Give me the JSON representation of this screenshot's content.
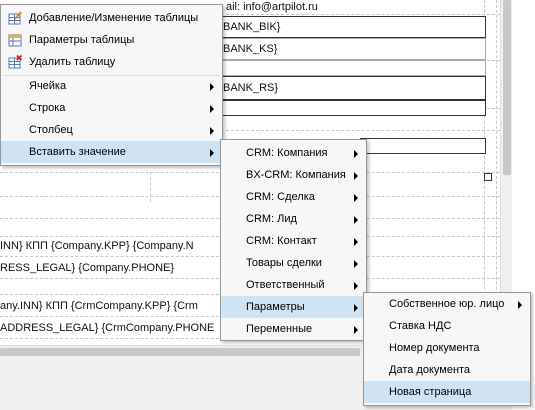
{
  "document": {
    "header_email": "ail: info@artpilot.ru",
    "field_bik": "BANK_BIK}",
    "field_ks": "BANK_KS}",
    "field_rs": "BANK_RS}",
    "row1": "INN} КПП {Company.KPP} {Company.N",
    "row2": "RESS_LEGAL} {Company.PHONE}",
    "row3": "any.INN} КПП {CrmCompany.KPP} {Crm",
    "row4": "ADDRESS_LEGAL} {CrmCompany.PHONE"
  },
  "menu1": {
    "items": [
      {
        "label": "Добавление/Изменение таблицы",
        "icon": "table-edit-icon"
      },
      {
        "label": "Параметры таблицы",
        "icon": "table-properties-icon"
      },
      {
        "label": "Удалить таблицу",
        "icon": "table-delete-icon"
      },
      {
        "label": "Ячейка"
      },
      {
        "label": "Строка"
      },
      {
        "label": "Столбец"
      },
      {
        "label": "Вставить значение"
      }
    ]
  },
  "menu2": {
    "items": [
      {
        "label": "CRM: Компания"
      },
      {
        "label": "BX-CRM: Компания"
      },
      {
        "label": "CRM: Сделка"
      },
      {
        "label": "CRM: Лид"
      },
      {
        "label": "CRM: Контакт"
      },
      {
        "label": "Товары сделки"
      },
      {
        "label": "Ответственный"
      },
      {
        "label": "Параметры"
      },
      {
        "label": "Переменные"
      }
    ]
  },
  "menu3": {
    "items": [
      {
        "label": "Собственное юр. лицо"
      },
      {
        "label": "Ставка НДС"
      },
      {
        "label": "Номер документа"
      },
      {
        "label": "Дата документа"
      },
      {
        "label": "Новая страница"
      }
    ]
  },
  "colors": {
    "highlight": "#cfe3f2",
    "menu_bg": "#f7f7f7",
    "menu_border": "#979797"
  }
}
